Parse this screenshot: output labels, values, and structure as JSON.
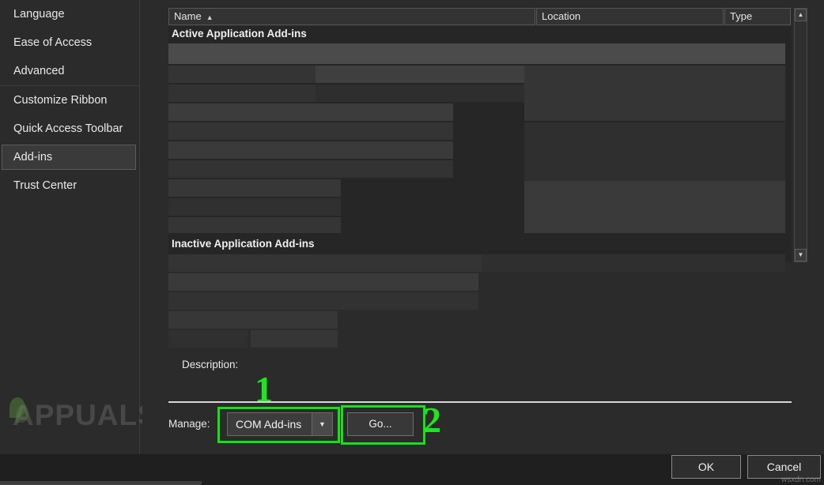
{
  "sidebar": {
    "items": [
      {
        "label": "Language",
        "selected": false
      },
      {
        "label": "Ease of Access",
        "selected": false
      },
      {
        "label": "Advanced",
        "selected": false
      },
      {
        "label": "Customize Ribbon",
        "selected": false
      },
      {
        "label": "Quick Access Toolbar",
        "selected": false
      },
      {
        "label": "Add-ins",
        "selected": true
      },
      {
        "label": "Trust Center",
        "selected": false
      }
    ]
  },
  "watermark": {
    "text": "APPUALS",
    "site": "wsxdn.com"
  },
  "list": {
    "columns": [
      {
        "label": "Name",
        "sort": "▲"
      },
      {
        "label": "Location",
        "sort": ""
      },
      {
        "label": "Type",
        "sort": ""
      }
    ],
    "groups": [
      {
        "label": "Active Application Add-ins"
      },
      {
        "label": "Inactive Application Add-ins"
      }
    ]
  },
  "scrollbar": {
    "up_icon": "▲",
    "down_icon": "▼"
  },
  "description": {
    "label": "Description:"
  },
  "manage": {
    "label": "Manage:",
    "selected_option": "COM Add-ins",
    "dropdown_icon": "▼",
    "go_button": "Go..."
  },
  "callouts": {
    "one": "1",
    "two": "2"
  },
  "footer": {
    "ok": "OK",
    "cancel": "Cancel"
  }
}
